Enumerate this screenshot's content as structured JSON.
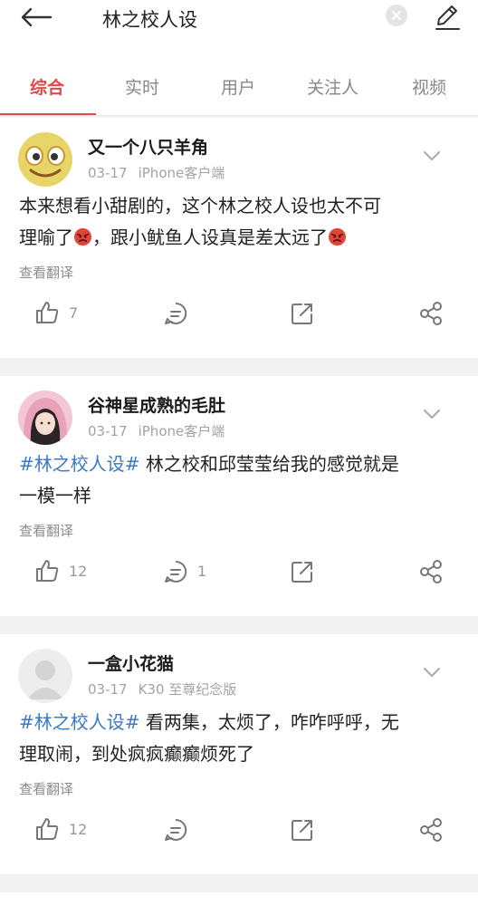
{
  "search": {
    "query": "林之校人设"
  },
  "tabs": [
    {
      "label": "综合"
    },
    {
      "label": "实时"
    },
    {
      "label": "用户"
    },
    {
      "label": "关注人"
    },
    {
      "label": "视频"
    }
  ],
  "translate_label": "查看翻译",
  "posts": [
    {
      "username": "又一个八只羊角",
      "date": "03-17",
      "source": "iPhone客户端",
      "hashtag": "",
      "text_line1": "本来想看小甜剧的，这个林之校人设也太不可",
      "text_line2a": "理喻了",
      "text_line2b": "，跟小鱿鱼人设真是差太远了",
      "likes": "7",
      "comments": ""
    },
    {
      "username": "谷神星成熟的毛肚",
      "date": "03-17",
      "source": "iPhone客户端",
      "hashtag": "#林之校人设#",
      "text_line1": " 林之校和邱莹莹给我的感觉就是",
      "text_line2": "一模一样",
      "likes": "12",
      "comments": "1"
    },
    {
      "username": "一盒小花猫",
      "date": "03-17",
      "source": "K30 至尊纪念版",
      "hashtag": "#林之校人设#",
      "text_line1": " 看两集，太烦了，咋咋呼呼，无",
      "text_line2": "理取闹，到处疯疯癫癫烦死了",
      "likes": "12",
      "comments": ""
    }
  ],
  "icons": [
    "back-arrow-icon",
    "clear-icon",
    "edit-icon",
    "chevron-down-icon",
    "like-icon",
    "comment-icon",
    "share-icon",
    "more-share-icon",
    "angry-emoji-icon"
  ],
  "colors": {
    "accent": "#e14a4a",
    "hashtag": "#3a79c4"
  }
}
